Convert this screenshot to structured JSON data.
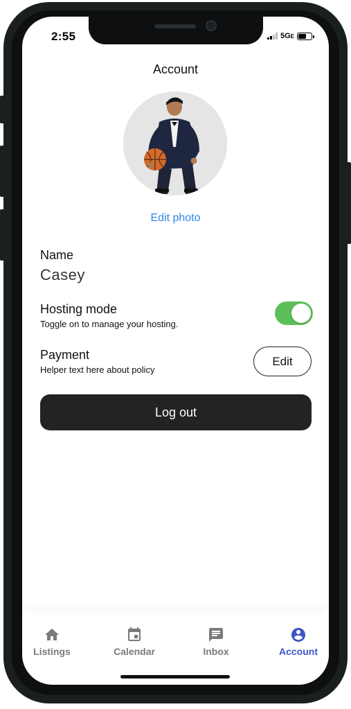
{
  "status_bar": {
    "time": "2:55",
    "network": "5G",
    "network_suffix": "E"
  },
  "header": {
    "title": "Account"
  },
  "profile": {
    "edit_photo_label": "Edit photo",
    "name_label": "Name",
    "name_value": "Casey"
  },
  "hosting": {
    "title": "Hosting mode",
    "helper": "Toggle on to manage your hosting.",
    "enabled": true
  },
  "payment": {
    "title": "Payment",
    "helper": "Helper text here about policy",
    "edit_label": "Edit"
  },
  "logout": {
    "label": "Log out"
  },
  "tabbar": {
    "tabs": [
      {
        "label": "Listings",
        "icon": "home-icon"
      },
      {
        "label": "Calendar",
        "icon": "calendar-icon"
      },
      {
        "label": "Inbox",
        "icon": "message-icon"
      },
      {
        "label": "Account",
        "icon": "account-icon",
        "active": true
      }
    ]
  },
  "colors": {
    "accent": "#3d55c7",
    "link": "#2f86e8",
    "toggle_on": "#5cbf5a",
    "button_dark": "#232323"
  }
}
